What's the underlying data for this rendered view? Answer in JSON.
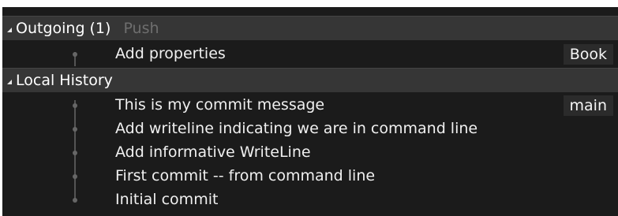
{
  "outgoing": {
    "title": "Outgoing",
    "count": "(1)",
    "action": "Push",
    "commits": [
      {
        "message": "Add properties",
        "branch": "Book"
      }
    ]
  },
  "local_history": {
    "title": "Local History",
    "commits": [
      {
        "message": "This is my commit message",
        "branch": "main"
      },
      {
        "message": "Add writeline indicating we are in command line"
      },
      {
        "message": "Add informative WriteLine"
      },
      {
        "message": "First commit -- from command line"
      },
      {
        "message": "Initial commit"
      }
    ]
  }
}
